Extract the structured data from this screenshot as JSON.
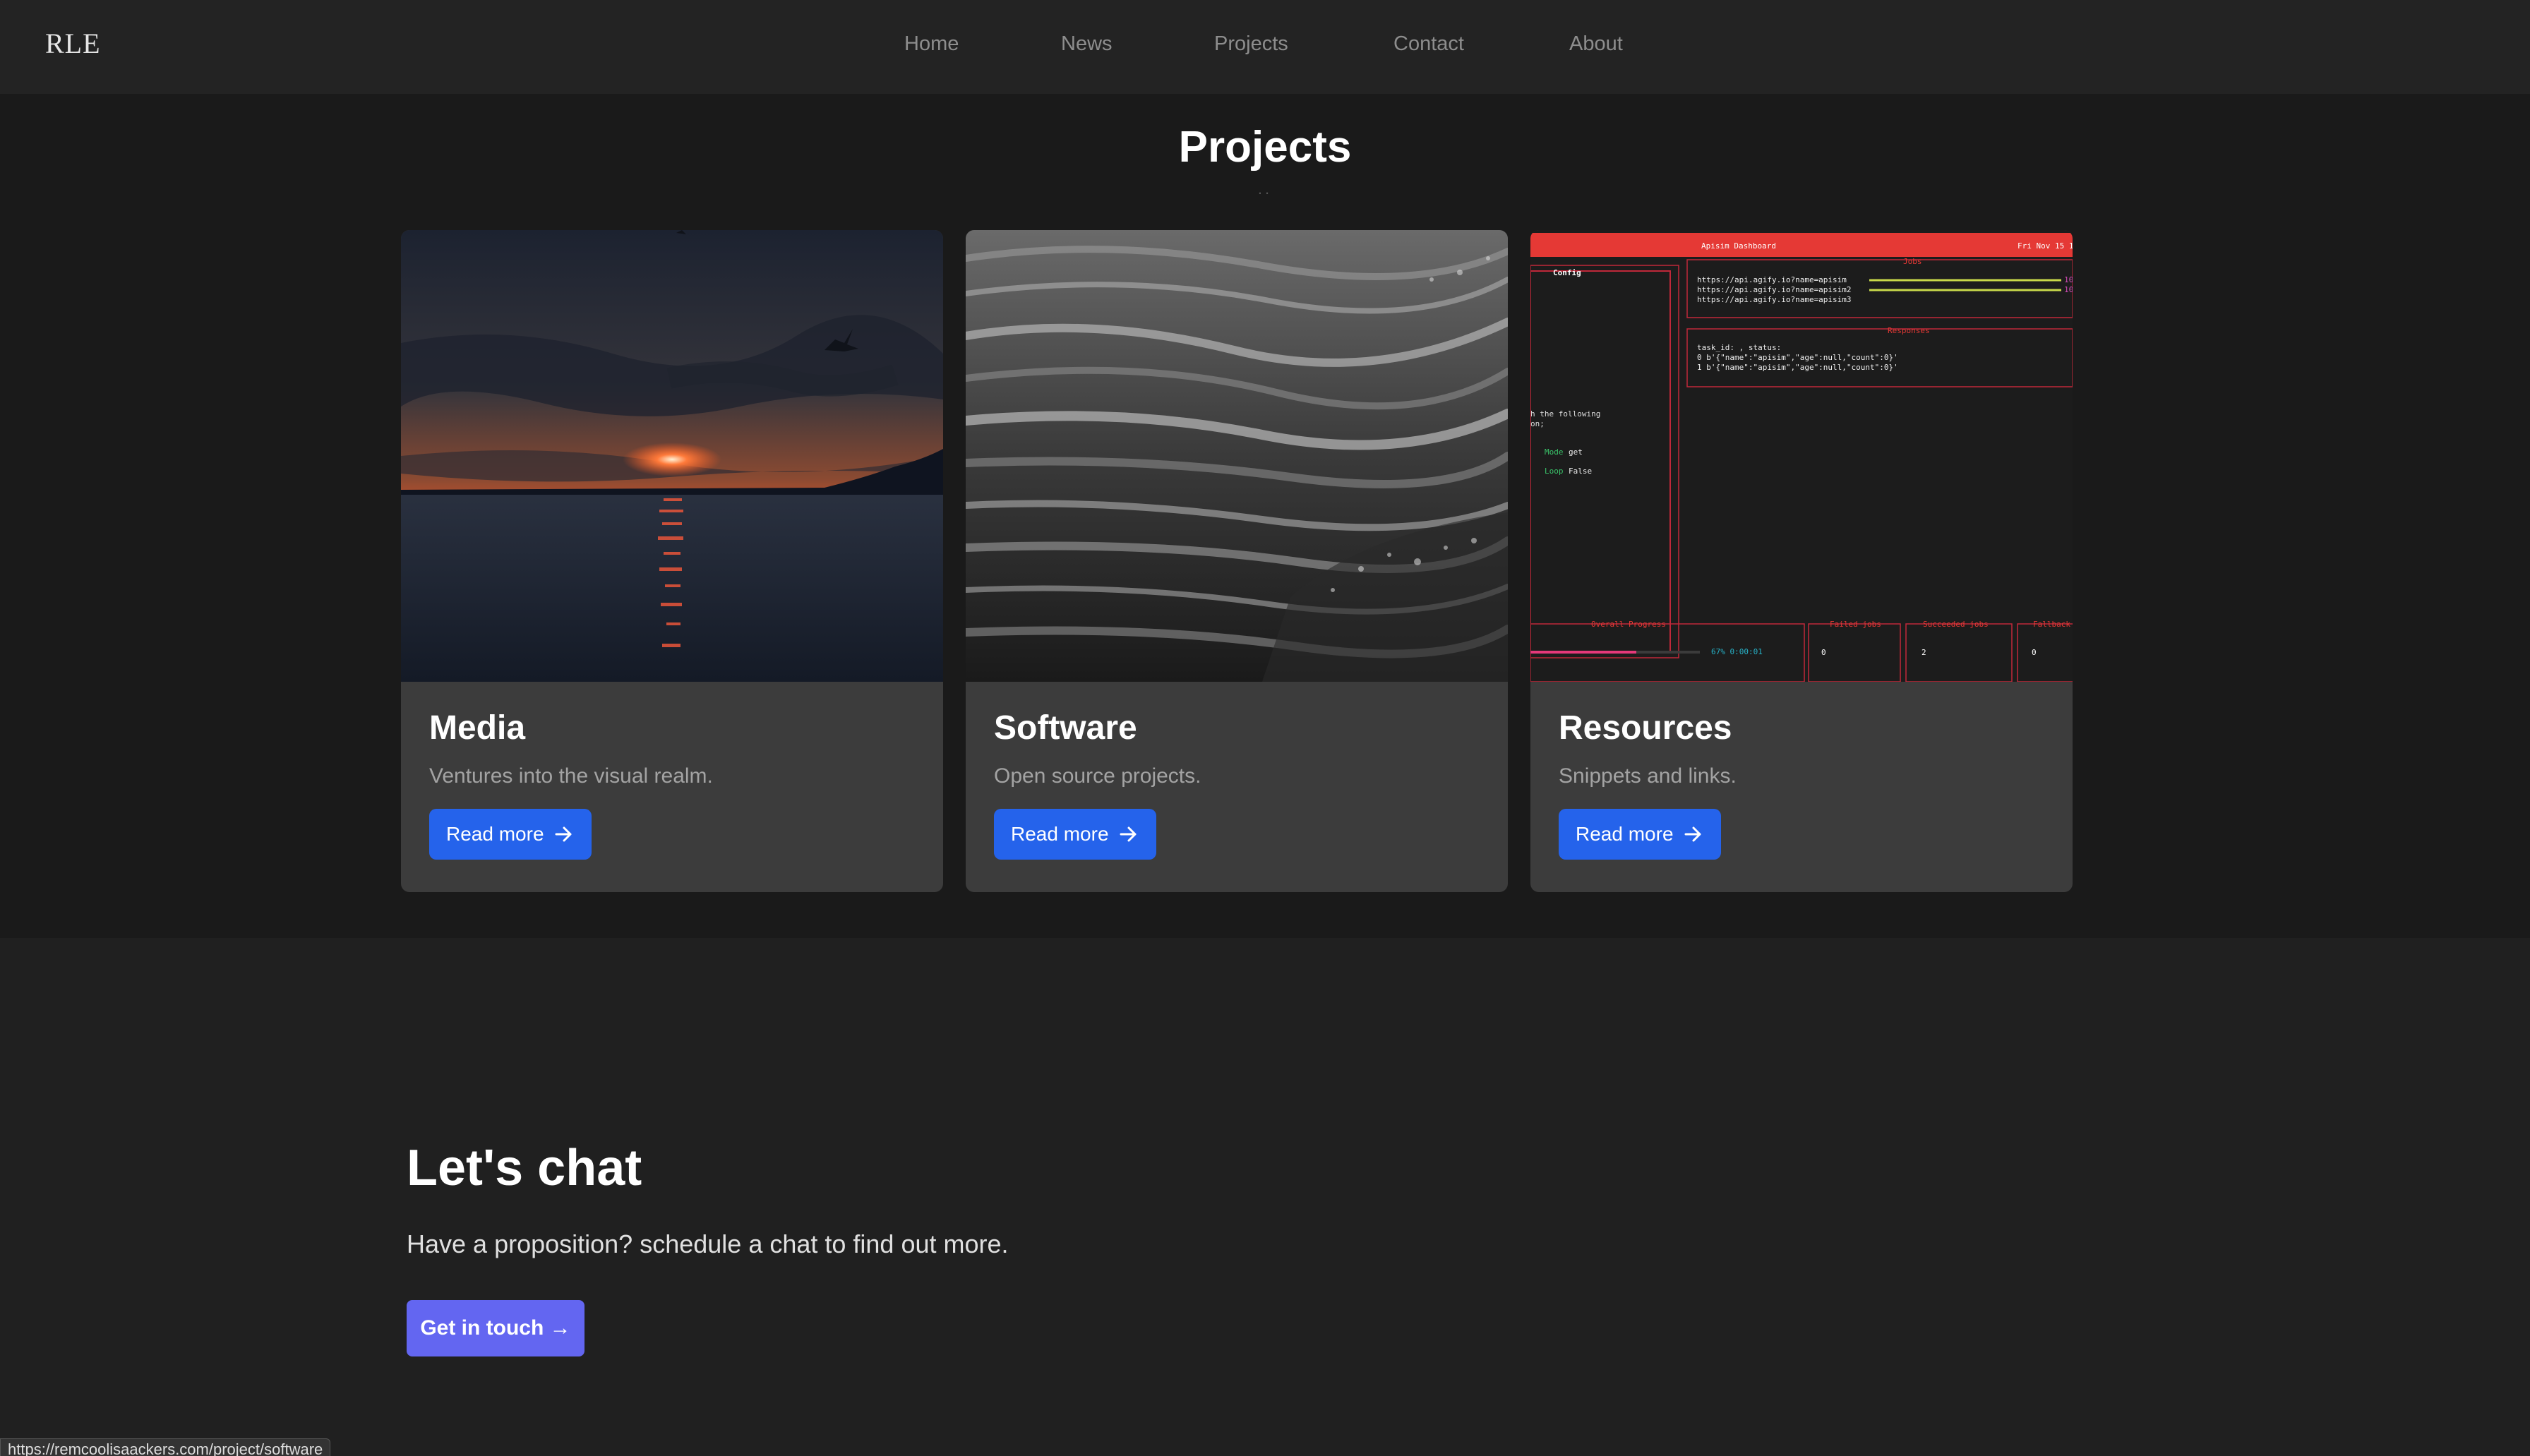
{
  "header": {
    "logo": "RLE",
    "nav": [
      {
        "label": "Home"
      },
      {
        "label": "News"
      },
      {
        "label": "Projects"
      },
      {
        "label": "Contact"
      },
      {
        "label": "About"
      }
    ]
  },
  "projects": {
    "title": "Projects",
    "dots": "..",
    "cards": [
      {
        "title": "Media",
        "description": "Ventures into the visual realm.",
        "button": "Read more",
        "image": "sunset-over-water"
      },
      {
        "title": "Software",
        "description": "Open source projects.",
        "button": "Read more",
        "image": "ocean-waves-bw"
      },
      {
        "title": "Resources",
        "description": "Snippets and links.",
        "button": "Read more",
        "image": "terminal-dashboard"
      }
    ]
  },
  "dashboard": {
    "title": "Apisim Dashboard",
    "date": "Fri Nov 15 1",
    "jobs_label": "Jobs",
    "config_label": "Config",
    "responses_label": "Responses",
    "urls": [
      "https://api.agify.io?name=apisim",
      "https://api.agify.io?name=apisim2",
      "https://api.agify.io?name=apisim3"
    ],
    "url_counts": [
      "10",
      "10"
    ],
    "responses": [
      "task_id: , status:",
      "0 b'{\"name\":\"apisim\",\"age\":null,\"count\":0}'",
      "1 b'{\"name\":\"apisim\",\"age\":null,\"count\":0}'"
    ],
    "config_text": [
      "h the following",
      "on;"
    ],
    "mode_label": "Mode",
    "mode_value": "get",
    "loop_label": "Loop",
    "loop_value": "False",
    "overall_progress_label": "Overall Progress",
    "progress_text": "67% 0:00:01",
    "progress": 0.67,
    "failed_label": "Failed jobs",
    "failed_value": "0",
    "succeeded_label": "Succeeded jobs",
    "succeeded_value": "2",
    "fallback_label": "Fallback",
    "fallback_value": "0"
  },
  "chat": {
    "title": "Let's chat",
    "text": "Have a proposition? schedule a chat to find out more.",
    "button": "Get in touch →"
  },
  "status_url": "https://remcoolisaackers.com/project/software",
  "colors": {
    "accent_blue": "#2563eb",
    "accent_indigo": "#6366f1",
    "terminal_red": "#e53935",
    "card_bg": "#3c3c3c"
  }
}
